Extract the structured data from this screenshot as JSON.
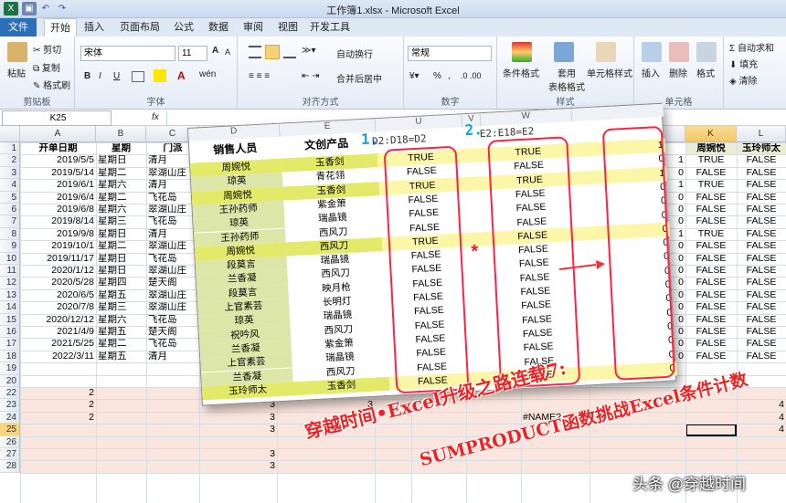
{
  "window": {
    "title": "工作簿1.xlsx - Microsoft Excel"
  },
  "tabs": [
    "文件",
    "开始",
    "插入",
    "页面布局",
    "公式",
    "数据",
    "审阅",
    "视图",
    "开发工具"
  ],
  "ribbon": {
    "clipboard": {
      "paste": "粘贴",
      "cut": "剪切",
      "copy": "复制",
      "format_painter": "格式刷",
      "label": "剪贴板"
    },
    "font": {
      "name": "宋体",
      "size": "11",
      "label": "字体",
      "b": "B",
      "i": "I",
      "u": "U",
      "a_up": "A",
      "a_dn": "A",
      "wen": "wén"
    },
    "align": {
      "wrap": "自动换行",
      "merge": "合并后居中",
      "label": "对齐方式"
    },
    "number": {
      "format": "常规",
      "label": "数字",
      "pct": "%"
    },
    "styles": {
      "cond": "条件格式",
      "table": "套用\n表格格式",
      "cellstyle": "单元格样式",
      "label": "样式"
    },
    "cells": {
      "insert": "插入",
      "delete": "删除",
      "format": "格式",
      "label": "单元格"
    },
    "edit": {
      "autosum": "Σ 自动求和",
      "fill": "填充",
      "clear": "清除"
    }
  },
  "formula_bar": {
    "name_box": "K25",
    "fx": "fx",
    "value": ""
  },
  "columns": [
    "A",
    "B",
    "C",
    "D",
    "E",
    "F",
    "G",
    "H",
    "I",
    "J",
    "K",
    "L"
  ],
  "header_row": [
    "开单日期",
    "星期",
    "门派",
    "销售人员",
    "文创产品",
    "",
    "",
    "",
    "",
    "D18=D2)",
    "周婉悦",
    "玉玲师太"
  ],
  "rows": [
    {
      "a": "2019/5/5",
      "b": "星期日",
      "c": "清月",
      "j": "1",
      "k": "TRUE",
      "l": "FALSE"
    },
    {
      "a": "2019/5/14",
      "b": "星期二",
      "c": "翠湖山庄",
      "j": "0",
      "k": "FALSE",
      "l": "FALSE"
    },
    {
      "a": "2019/6/1",
      "b": "星期六",
      "c": "清月",
      "j": "1",
      "k": "TRUE",
      "l": "FALSE"
    },
    {
      "a": "2019/6/4",
      "b": "星期二",
      "c": "飞花岛",
      "j": "0",
      "k": "FALSE",
      "l": "FALSE"
    },
    {
      "a": "2019/6/8",
      "b": "星期六",
      "c": "翠湖山庄",
      "j": "0",
      "k": "FALSE",
      "l": "FALSE"
    },
    {
      "a": "2019/8/14",
      "b": "星期三",
      "c": "飞花岛",
      "j": "0",
      "k": "FALSE",
      "l": "FALSE"
    },
    {
      "a": "2019/9/8",
      "b": "星期日",
      "c": "清月",
      "j": "1",
      "k": "TRUE",
      "l": "FALSE"
    },
    {
      "a": "2019/10/1",
      "b": "星期二",
      "c": "翠湖山庄",
      "j": "0",
      "k": "FALSE",
      "l": "FALSE"
    },
    {
      "a": "2019/11/17",
      "b": "星期日",
      "c": "飞花岛",
      "j": "0",
      "k": "FALSE",
      "l": "FALSE"
    },
    {
      "a": "2020/1/12",
      "b": "星期日",
      "c": "翠湖山庄",
      "j": "0",
      "k": "FALSE",
      "l": "FALSE"
    },
    {
      "a": "2020/5/28",
      "b": "星期四",
      "c": "楚天阁",
      "j": "0",
      "k": "FALSE",
      "l": "FALSE"
    },
    {
      "a": "2020/6/5",
      "b": "星期五",
      "c": "翠湖山庄",
      "j": "0",
      "k": "FALSE",
      "l": "FALSE"
    },
    {
      "a": "2020/7/8",
      "b": "星期三",
      "c": "翠湖山庄",
      "j": "0",
      "k": "FALSE",
      "l": "FALSE"
    },
    {
      "a": "2020/12/12",
      "b": "星期六",
      "c": "飞花岛",
      "j": "0",
      "k": "FALSE",
      "l": "FALSE"
    },
    {
      "a": "2021/4/9",
      "b": "星期五",
      "c": "楚天阁",
      "j": "0",
      "k": "FALSE",
      "l": "FALSE"
    },
    {
      "a": "2021/5/25",
      "b": "星期二",
      "c": "飞花岛",
      "j": "0",
      "k": "FALSE",
      "l": "FALSE"
    },
    {
      "a": "2022/3/11",
      "b": "星期五",
      "c": "清月",
      "j": "0",
      "k": "FALSE",
      "l": "FALSE"
    }
  ],
  "lower_rows": [
    {
      "r": "22",
      "a": "2",
      "d": "",
      "e": "",
      "k": "",
      "l": ""
    },
    {
      "r": "23",
      "a": "2",
      "d": "3",
      "e": "3",
      "k": "",
      "l": "4"
    },
    {
      "r": "24",
      "a": "2",
      "d": "3",
      "e": "3",
      "i": "#NAME?",
      "k": "",
      "l": "4"
    },
    {
      "r": "25",
      "a": "",
      "d": "3",
      "e": "",
      "k": "",
      "l": "4"
    },
    {
      "r": "26",
      "a": "",
      "d": "",
      "e": "",
      "k": "",
      "l": ""
    },
    {
      "r": "27",
      "a": "",
      "d": "3",
      "e": "",
      "k": "",
      "l": ""
    },
    {
      "r": "28",
      "a": "",
      "d": "3",
      "e": "",
      "k": "",
      "l": ""
    }
  ],
  "overlay": {
    "col_letters": [
      "D",
      "E",
      "U",
      "V",
      "W"
    ],
    "headers": [
      "销售人员",
      "文创产品"
    ],
    "label1": "1.",
    "formula1": "D2:D18=D2",
    "label2": "2.",
    "formula2": "E2:E18=E2",
    "people": [
      "周婉悦",
      "琼英",
      "周婉悦",
      "王孙药师",
      "琼英",
      "王孙药师",
      "周婉悦",
      "段莫言",
      "兰香凝",
      "段莫言",
      "上官素芸",
      "琼英",
      "祝吟风",
      "兰香凝",
      "上官素芸",
      "兰香凝",
      "玉玲师太"
    ],
    "products": [
      "玉香剑",
      "青花翎",
      "玉香剑",
      "紫金箫",
      "瑞晶镜",
      "西风刀",
      "西风刀",
      "瑞晶镜",
      "西风刀",
      "映月枪",
      "长明灯",
      "瑞晶镜",
      "西风刀",
      "紫金箫",
      "瑞晶镜",
      "西风刀",
      "玉香剑"
    ],
    "col_u": [
      "TRUE",
      "FALSE",
      "TRUE",
      "FALSE",
      "FALSE",
      "FALSE",
      "TRUE",
      "FALSE",
      "FALSE",
      "FALSE",
      "FALSE",
      "FALSE",
      "FALSE",
      "FALSE",
      "FALSE",
      "FALSE",
      "FALSE"
    ],
    "col_w": [
      "TRUE",
      "FALSE",
      "TRUE",
      "FALSE",
      "FALSE",
      "FALSE",
      "FALSE",
      "FALSE",
      "FALSE",
      "FALSE",
      "FALSE",
      "FALSE",
      "FALSE",
      "FALSE",
      "FALSE",
      "FALSE",
      "TRUE"
    ],
    "col_x": [
      "1",
      "0",
      "1",
      "0",
      "0",
      "0",
      "0",
      "0",
      "0",
      "0",
      "0",
      "0",
      "0",
      "0",
      "0",
      "0",
      "0"
    ],
    "star": "*"
  },
  "watermark": {
    "line1": "穿越时间•Excel升级之路连载7:",
    "line2": "SUMPRODUCT函数挑战Excel条件计数",
    "credit": "头条 @穿越时间"
  }
}
